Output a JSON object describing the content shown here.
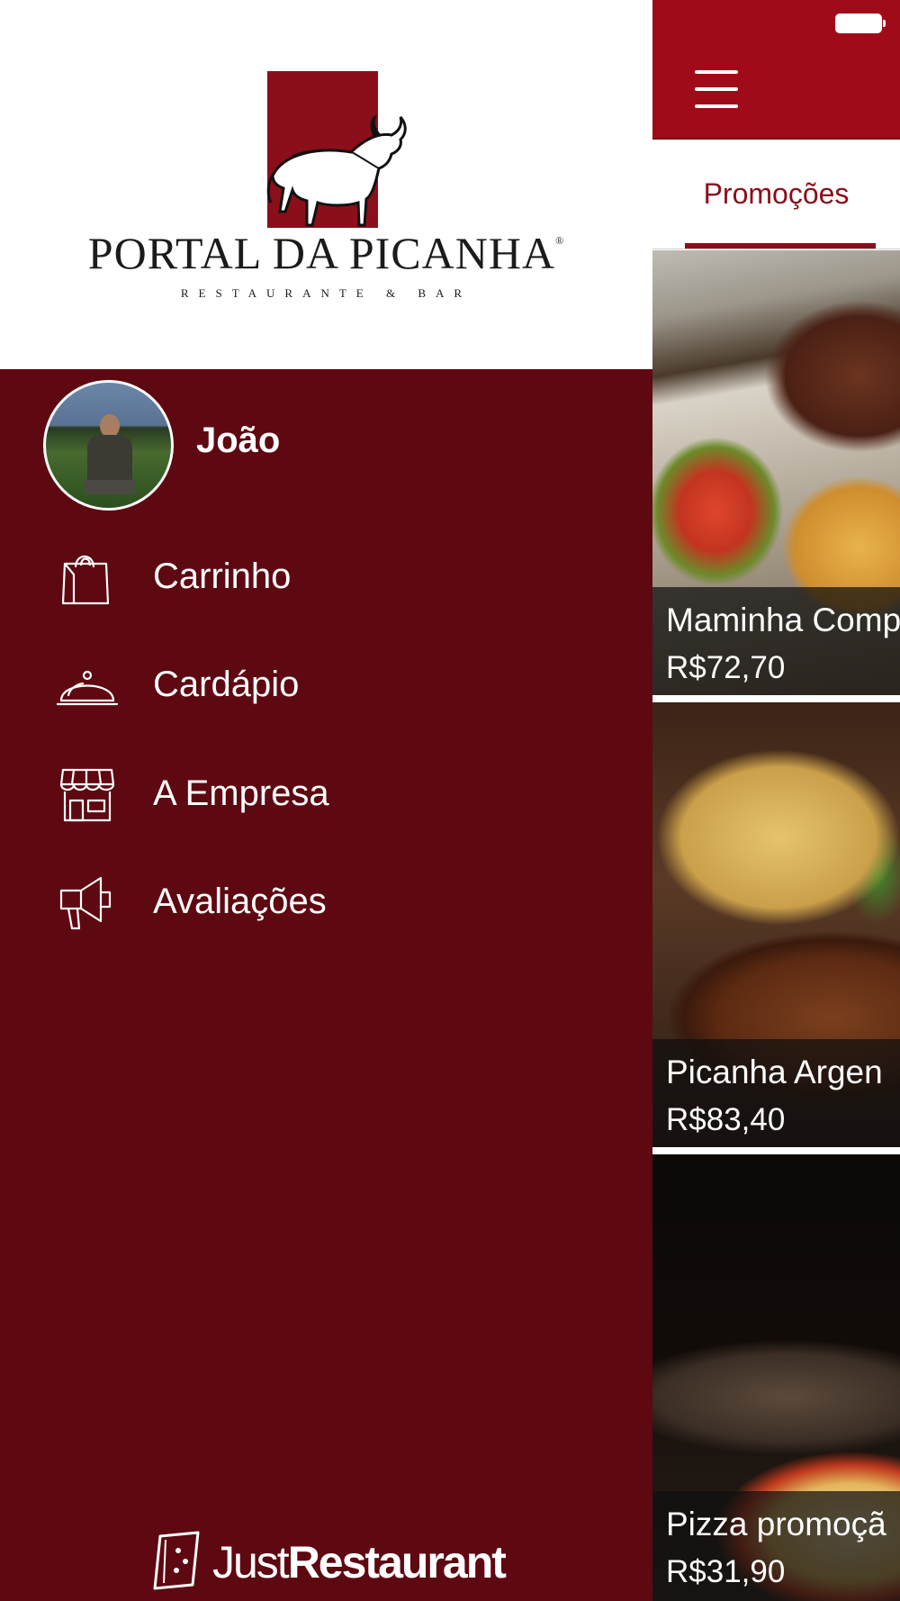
{
  "brand": {
    "name": "PORTAL DA PICANHA",
    "registered_mark": "®",
    "tagline": "RESTAURANTE & BAR"
  },
  "user": {
    "name": "João"
  },
  "menu": {
    "items": [
      {
        "label": "Carrinho",
        "icon": "shopping-bag-icon"
      },
      {
        "label": "Cardápio",
        "icon": "food-cloche-icon"
      },
      {
        "label": "A Empresa",
        "icon": "storefront-icon"
      },
      {
        "label": "Avaliações",
        "icon": "megaphone-icon"
      }
    ]
  },
  "footer": {
    "brand_light": "Just",
    "brand_bold": "Restaurant"
  },
  "main": {
    "tab_label": "Promoções",
    "promotions": [
      {
        "name": "Maminha Comp",
        "price": "R$72,70"
      },
      {
        "name": "Picanha Argen",
        "price": "R$83,40"
      },
      {
        "name": "Pizza promoçã",
        "price": "R$31,90"
      }
    ]
  },
  "colors": {
    "drawer_bg": "#5e0812",
    "app_bar": "#a00b19",
    "accent": "#8a0f1a"
  }
}
